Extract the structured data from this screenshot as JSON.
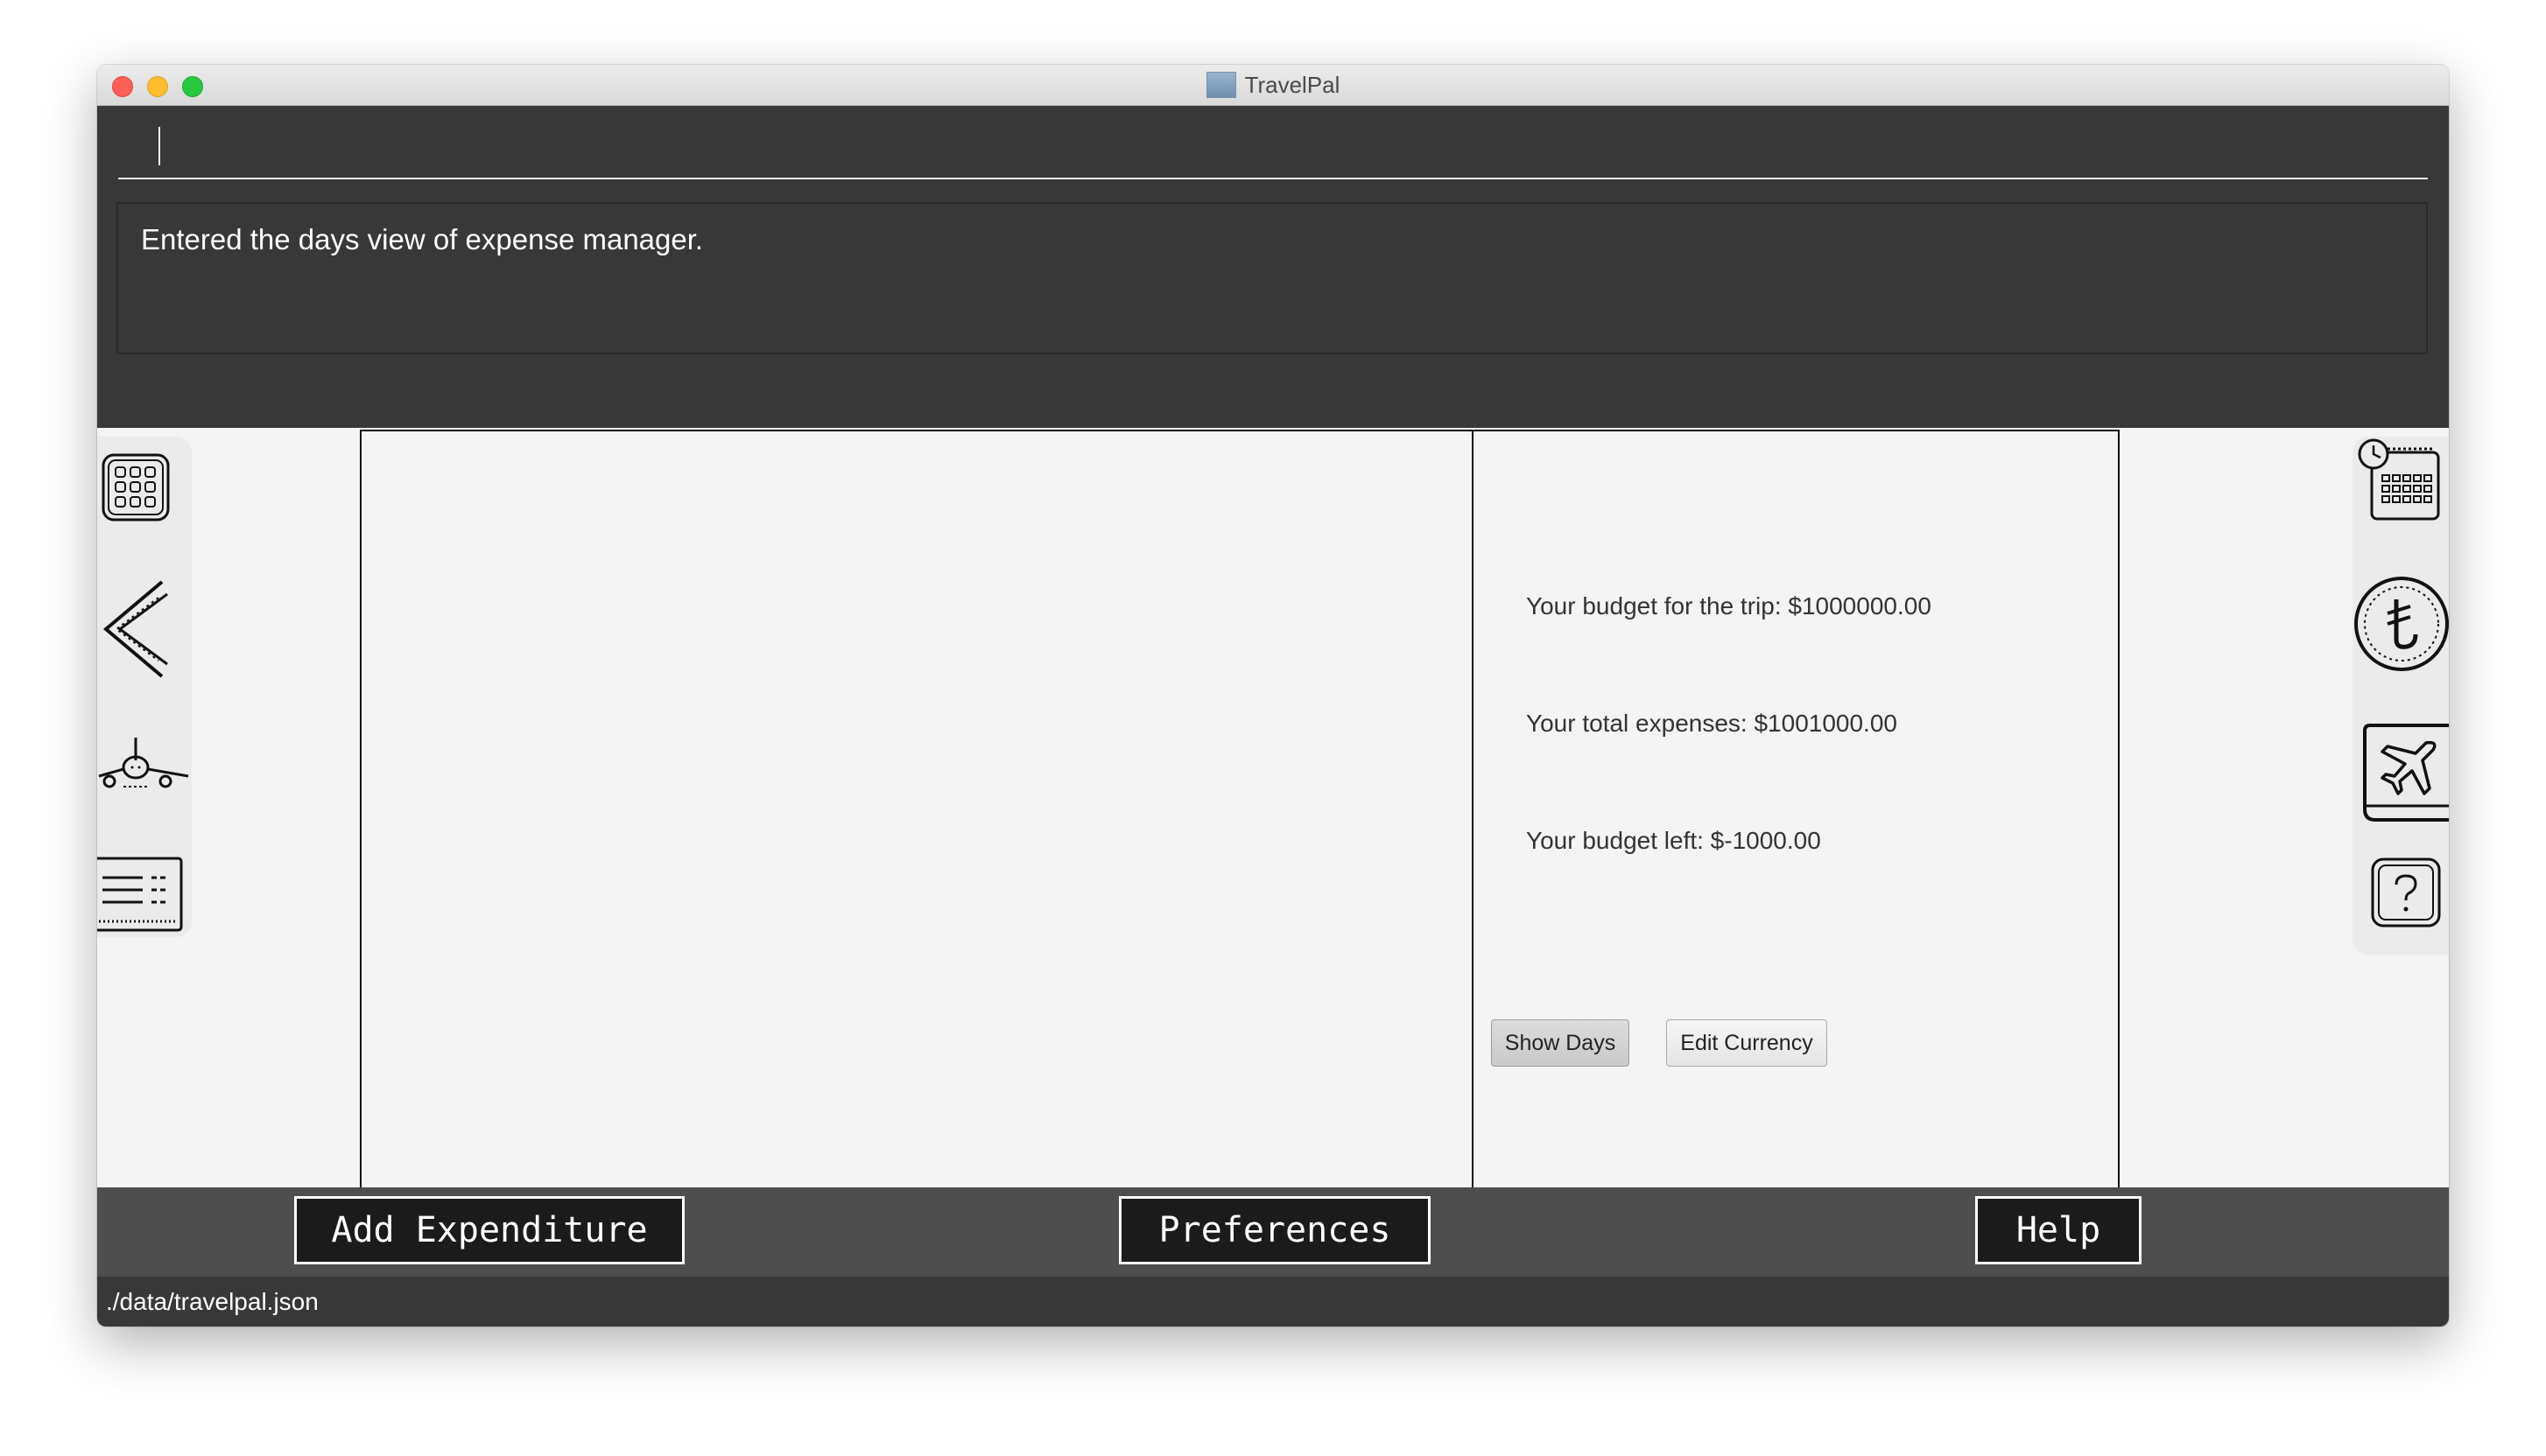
{
  "window": {
    "title": "TravelPal"
  },
  "command": {
    "value": ""
  },
  "result": {
    "message": "Entered the days view of expense manager."
  },
  "left_nav": {
    "items": [
      {
        "icon": "itinerary-grid-icon"
      },
      {
        "icon": "back-arrow-icon"
      },
      {
        "icon": "airplane-icon"
      },
      {
        "icon": "list-document-icon"
      }
    ]
  },
  "right_nav": {
    "items": [
      {
        "icon": "calendar-clock-icon"
      },
      {
        "icon": "currency-coin-icon"
      },
      {
        "icon": "flight-booking-icon"
      },
      {
        "icon": "help-question-icon"
      }
    ]
  },
  "summary": {
    "budget": "Your budget for the trip: $1000000.00",
    "total": "Your total expenses: $1001000.00",
    "left": "Your budget left: $-1000.00",
    "show_days": "Show Days",
    "edit_currency": "Edit Currency"
  },
  "bottom": {
    "add_expenditure": "Add Expenditure",
    "preferences": "Preferences",
    "help": "Help"
  },
  "status": {
    "path": "./data/travelpal.json"
  }
}
